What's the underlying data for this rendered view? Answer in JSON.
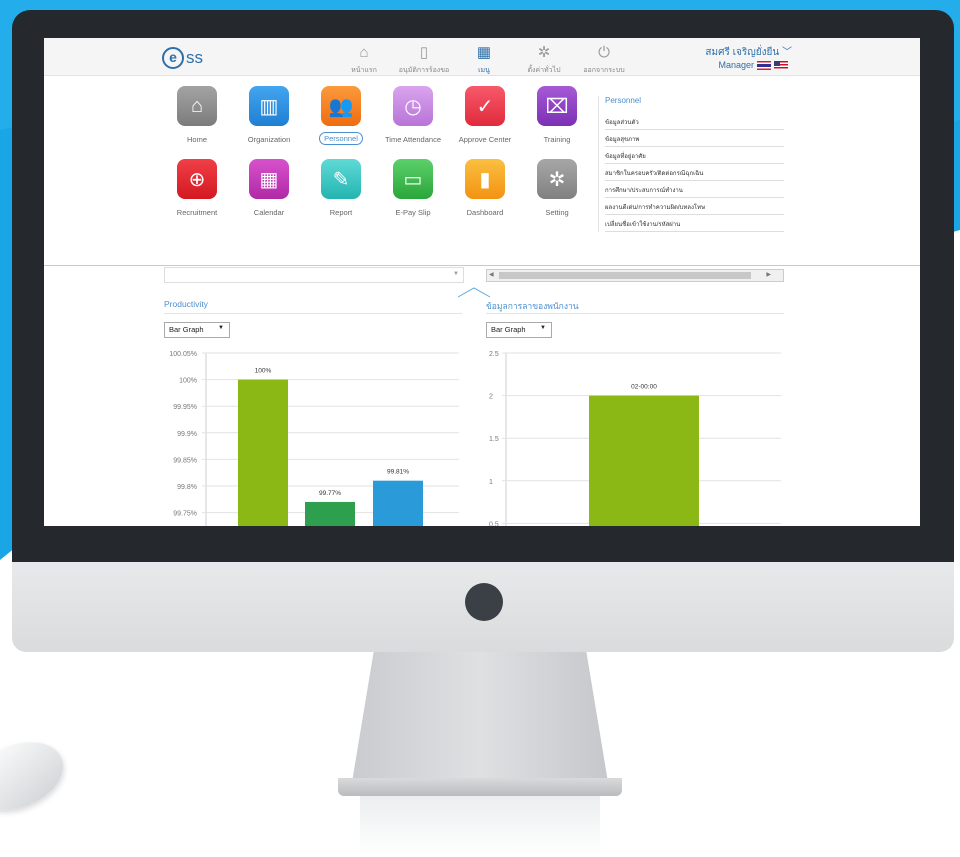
{
  "topbar": {
    "logo_text": "ss",
    "nav": [
      {
        "label": "หน้าแรก",
        "icon": "home-icon",
        "active": false
      },
      {
        "label": "อนุมัติการร้องขอ",
        "icon": "document-check-icon",
        "active": false
      },
      {
        "label": "เมนู",
        "icon": "grid-menu-icon",
        "active": true
      },
      {
        "label": "ตั้งค่าทั่วไป",
        "icon": "gear-icon",
        "active": false
      },
      {
        "label": "ออกจากระบบ",
        "icon": "power-icon",
        "active": false
      }
    ],
    "user_name": "สมศรี เจริญยั่งยืน",
    "user_role": "Manager"
  },
  "apps": [
    {
      "label": "Home",
      "icon": "home-icon",
      "color": "#8e8e8e"
    },
    {
      "label": "Organization",
      "icon": "building-icon",
      "color": "#2f8fe0"
    },
    {
      "label": "Personnel",
      "icon": "people-icon",
      "color": "#f47a20",
      "selected": true
    },
    {
      "label": "Time Attendance",
      "icon": "clock-icon",
      "color": "#c987e0"
    },
    {
      "label": "Approve Center",
      "icon": "check-circle-icon",
      "color": "#ef3d4f"
    },
    {
      "label": "Training",
      "icon": "presentation-icon",
      "color": "#8e3fc2"
    },
    {
      "label": "Recruitment",
      "icon": "add-person-icon",
      "color": "#e4232d"
    },
    {
      "label": "Calendar",
      "icon": "calendar-icon",
      "color": "#c23bb7"
    },
    {
      "label": "Report",
      "icon": "edit-document-icon",
      "color": "#2bc3c0"
    },
    {
      "label": "E-Pay Slip",
      "icon": "payslip-card-icon",
      "color": "#3bb54a"
    },
    {
      "label": "Dashboard",
      "icon": "bar-chart-icon",
      "color": "#f7a81b"
    },
    {
      "label": "Setting",
      "icon": "gear-icon",
      "color": "#8a8a8a"
    }
  ],
  "submenu": {
    "title": "Personnel",
    "items": [
      "ข้อมูลส่วนตัว",
      "ข้อมูลสุขภาพ",
      "ข้อมูลที่อยู่อาศัย",
      "สมาชิกในครอบครัว/ติดต่อกรณีฉุกเฉิน",
      "การศึกษา/ประสบการณ์ทำงาน",
      "ผลงานดีเด่น/การทำความผิด/บทลงโทษ",
      "เปลี่ยนชื่อเข้าใช้งาน/รหัสผ่าน"
    ]
  },
  "panels": {
    "left": {
      "title": "Productivity",
      "select_value": "Bar Graph"
    },
    "right": {
      "title": "ข้อมูลการลาของพนักงาน",
      "select_value": "Bar Graph"
    }
  },
  "chart_data": [
    {
      "type": "bar",
      "title": "Productivity",
      "ylim": [
        99.75,
        100.05
      ],
      "yticks": [
        "100.05%",
        "100%",
        "99.95%",
        "99.9%",
        "99.85%",
        "99.8%",
        "99.75%"
      ],
      "bars": [
        {
          "value": 100,
          "label": "100%",
          "color": "#8bb814"
        },
        {
          "value": 99.77,
          "label": "99.77%",
          "color": "#2e9e4f"
        },
        {
          "value": 99.81,
          "label": "99.81%",
          "color": "#2a9ad8"
        }
      ]
    },
    {
      "type": "bar",
      "title": "ข้อมูลการลาของพนักงาน",
      "ylim": [
        0.5,
        2.5
      ],
      "yticks": [
        "2.5",
        "2",
        "1.5",
        "1",
        "0.5"
      ],
      "bars": [
        {
          "value": 2,
          "label": "02-00:00",
          "color": "#8bb814"
        }
      ]
    }
  ]
}
